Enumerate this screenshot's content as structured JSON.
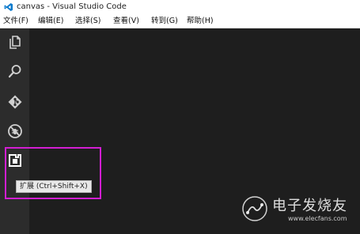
{
  "window": {
    "title": "canvas - Visual Studio Code",
    "logo_icon": "vscode-logo-icon",
    "accent_color": "#0a7acc"
  },
  "menubar": {
    "items": [
      {
        "label": "文件(F)"
      },
      {
        "label": "编辑(E)"
      },
      {
        "label": "选择(S)"
      },
      {
        "label": "查看(V)"
      },
      {
        "label": "转到(G)"
      },
      {
        "label": "帮助(H)"
      }
    ]
  },
  "activitybar": {
    "items": [
      {
        "name": "explorer",
        "icon": "files-icon"
      },
      {
        "name": "search",
        "icon": "search-icon"
      },
      {
        "name": "source-control",
        "icon": "git-icon"
      },
      {
        "name": "debug",
        "icon": "debug-no-bug-icon"
      },
      {
        "name": "extensions",
        "icon": "extensions-icon",
        "active": true
      }
    ]
  },
  "tooltip": {
    "text": "扩展 (Ctrl+Shift+X)"
  },
  "highlight": {
    "color": "#d21ed2"
  },
  "watermark": {
    "brand": "电子发烧友",
    "url": "www.elecfans.com"
  }
}
